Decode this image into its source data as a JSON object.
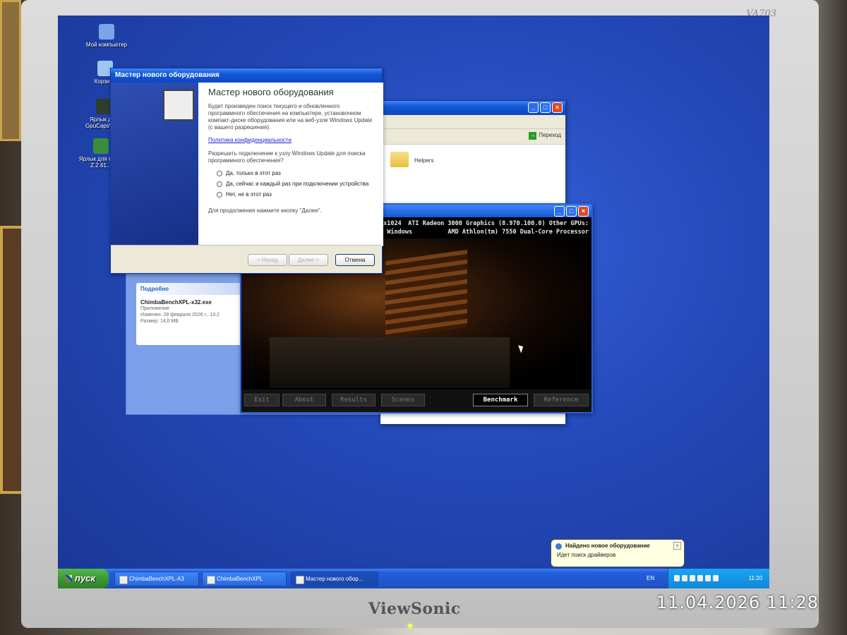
{
  "monitor": {
    "brand": "ViewSonic",
    "model": "VA703"
  },
  "photo_stamp": "11.04.2026 11:28",
  "desktop_icons": [
    {
      "label": "Мой компьютер",
      "icon": "my-computer-icon",
      "color": "#7aa6e8"
    },
    {
      "label": "Корзина",
      "icon": "recycle-bin-icon",
      "color": "#9ec6ef"
    },
    {
      "label": "Ярлык для GpuCapsVie...",
      "icon": "gpucaps-shortcut-icon",
      "color": "#2d3d2d"
    },
    {
      "label": "Ярлык для GPU-Z.2.61...",
      "icon": "gpuz-shortcut-icon",
      "color": "#3a8e3a"
    }
  ],
  "wizard": {
    "title": "Мастер нового оборудования",
    "heading": "Мастер нового оборудования",
    "paragraph": "Будет произведен поиск текущего и обновленного программного обеспечения на компьютере, установочном компакт-диске оборудования или на веб-узле Windows Update (с вашего разрешения).",
    "privacy_link": "Политика конфиденциальности",
    "question": "Разрешить подключение к узлу Windows Update для поиска программного обеспечения?",
    "options": [
      "Да, только в этот раз",
      "Да, сейчас и каждый раз при подключении устройства",
      "Нет, не в этот раз"
    ],
    "continue_hint": "Для продолжения нажмите кнопку \"Далее\".",
    "back_label": "< Назад",
    "next_label": "Далее >",
    "cancel_label": "Отмена"
  },
  "explorer": {
    "go_label": "Переход",
    "folder_label": "Helpers"
  },
  "details_pane": {
    "header": "Подробно",
    "file_name": "ChimbaBenchXPL-x32.exe",
    "type": "Приложение",
    "modified": "Изменен: 28 февраля 2026 г., 13:2",
    "size": "Размер: 14,0 МБ"
  },
  "benchmark": {
    "hud_left_1": "0x1024",
    "hud_left_2": "t Windows",
    "hud_gpu": "ATI Radeon 3000 Graphics (8.970.100.0) Other GPUs:",
    "hud_cpu": "AMD Athlon(tm) 7550 Dual-Core Processor",
    "buttons": [
      "Exit",
      "About",
      "Results",
      "Scenes",
      "Benchmark",
      "Reference"
    ],
    "active_button": "Benchmark"
  },
  "balloon": {
    "title": "Найдено новое оборудование",
    "text": "Идет поиск драйверов"
  },
  "taskbar": {
    "start_label": "пуск",
    "tasks": [
      "ChimbaBenchXPL-A3",
      "ChimbaBenchXPL",
      "Мастер нового обор..."
    ],
    "language": "EN",
    "clock": "11:20"
  }
}
